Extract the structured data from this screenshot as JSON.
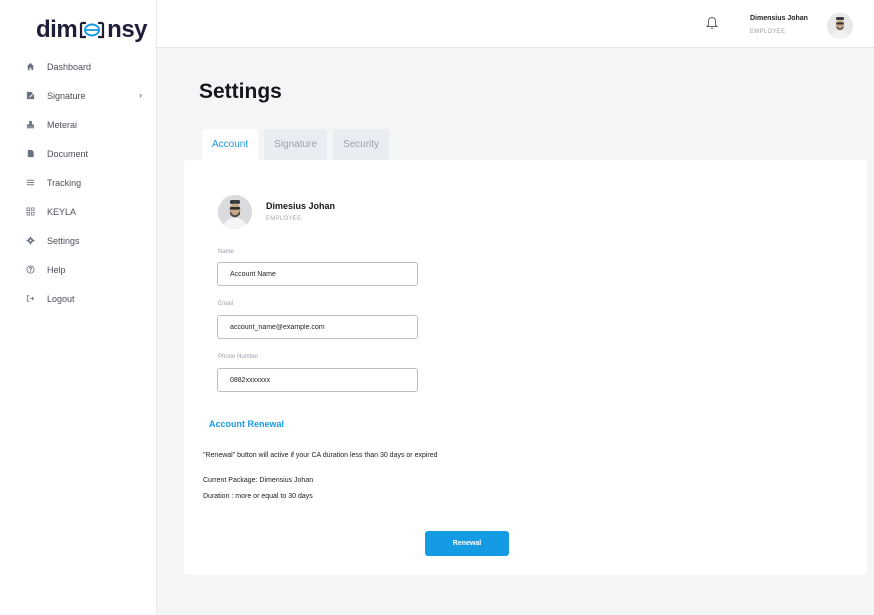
{
  "brand": {
    "logo_left": "dim",
    "logo_right": "nsy",
    "accent": "#1a9ae0"
  },
  "sidebar": {
    "items": [
      {
        "label": "Dashboard",
        "icon": "home-icon"
      },
      {
        "label": "Signature",
        "icon": "pen-icon",
        "has_chevron": true
      },
      {
        "label": "Meterai",
        "icon": "stamp-icon"
      },
      {
        "label": "Document",
        "icon": "document-icon"
      },
      {
        "label": "Tracking",
        "icon": "list-icon"
      },
      {
        "label": "KEYLA",
        "icon": "grid-icon"
      },
      {
        "label": "Settings",
        "icon": "gear-icon"
      },
      {
        "label": "Help",
        "icon": "help-icon"
      },
      {
        "label": "Logout",
        "icon": "logout-icon"
      }
    ]
  },
  "header": {
    "user_name": "Dimensius Johan",
    "user_role": "EMPLOYEE"
  },
  "main": {
    "title": "Settings",
    "tabs": [
      {
        "label": "Account",
        "active": true
      },
      {
        "label": "Signature",
        "active": false
      },
      {
        "label": "Security",
        "active": false
      }
    ],
    "profile": {
      "name": "Dimesius Johan",
      "role": "EMPLOYEE"
    },
    "fields": {
      "name": {
        "label": "Name",
        "value": "Account Name"
      },
      "email": {
        "label": "Email",
        "value": "account_name@example.com"
      },
      "phone": {
        "label": "Phone Number",
        "value": "0882xxxxxxx"
      }
    },
    "renewal": {
      "title": "Account Renewal",
      "note": "\"Renewal\" button will active if your CA duration less than 30 days or expired",
      "package": "Current Package: Dimensius Johan",
      "duration": "Duration : more or equal to 30 days",
      "button_label": "Renewal"
    }
  }
}
